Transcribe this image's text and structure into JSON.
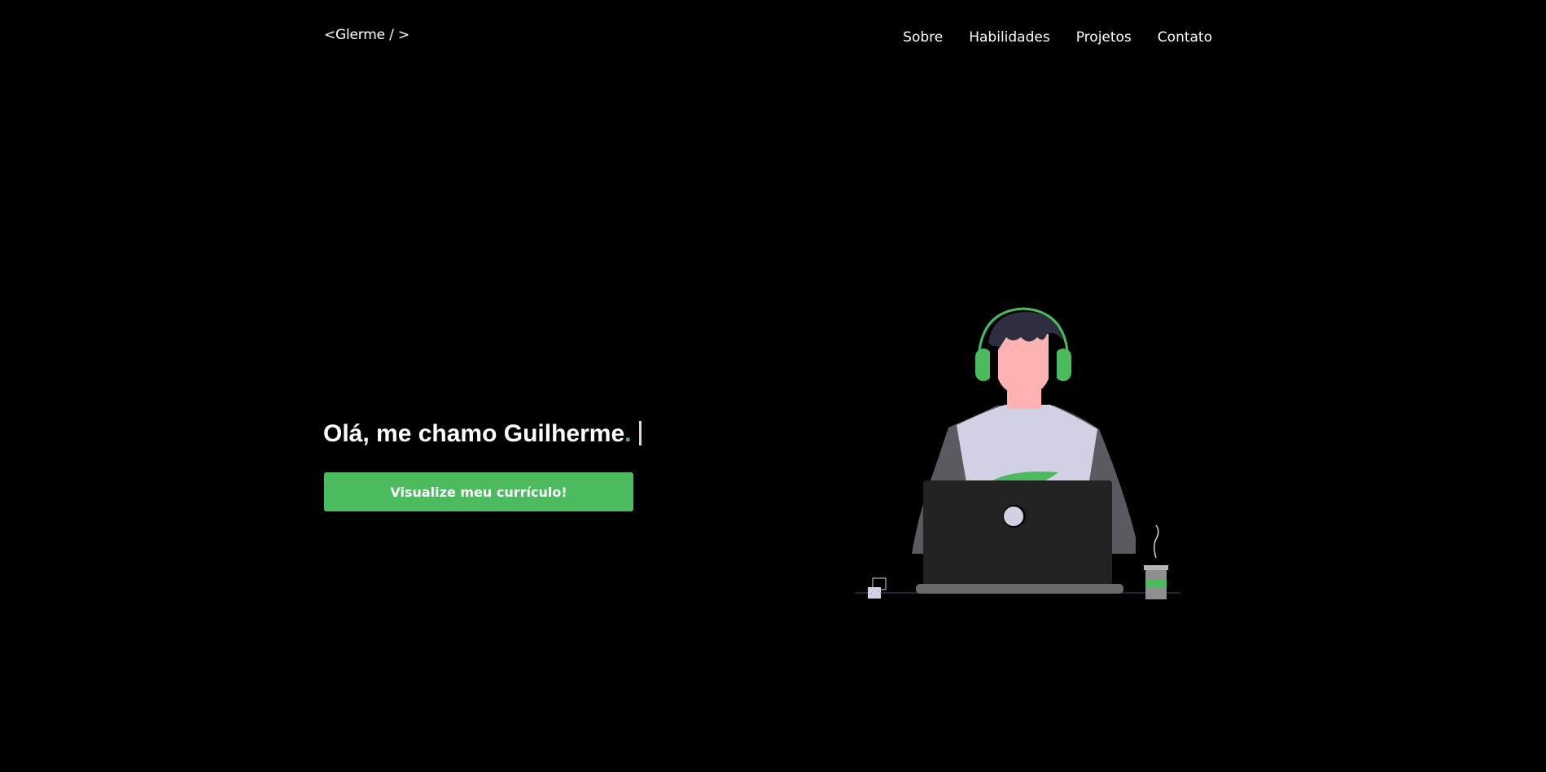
{
  "header": {
    "logo": "<Glerme / >",
    "nav": [
      {
        "label": "Sobre"
      },
      {
        "label": "Habilidades"
      },
      {
        "label": "Projetos"
      },
      {
        "label": "Contato"
      }
    ]
  },
  "hero": {
    "greeting": "Olá, me chamo Guilherme",
    "dot": ".",
    "button_label": "Visualize meu currículo!"
  },
  "colors": {
    "background": "#000000",
    "accent": "#4cba5f",
    "text": "#ffffff"
  },
  "illustration": {
    "icon": "developer-with-laptop-illustration"
  }
}
